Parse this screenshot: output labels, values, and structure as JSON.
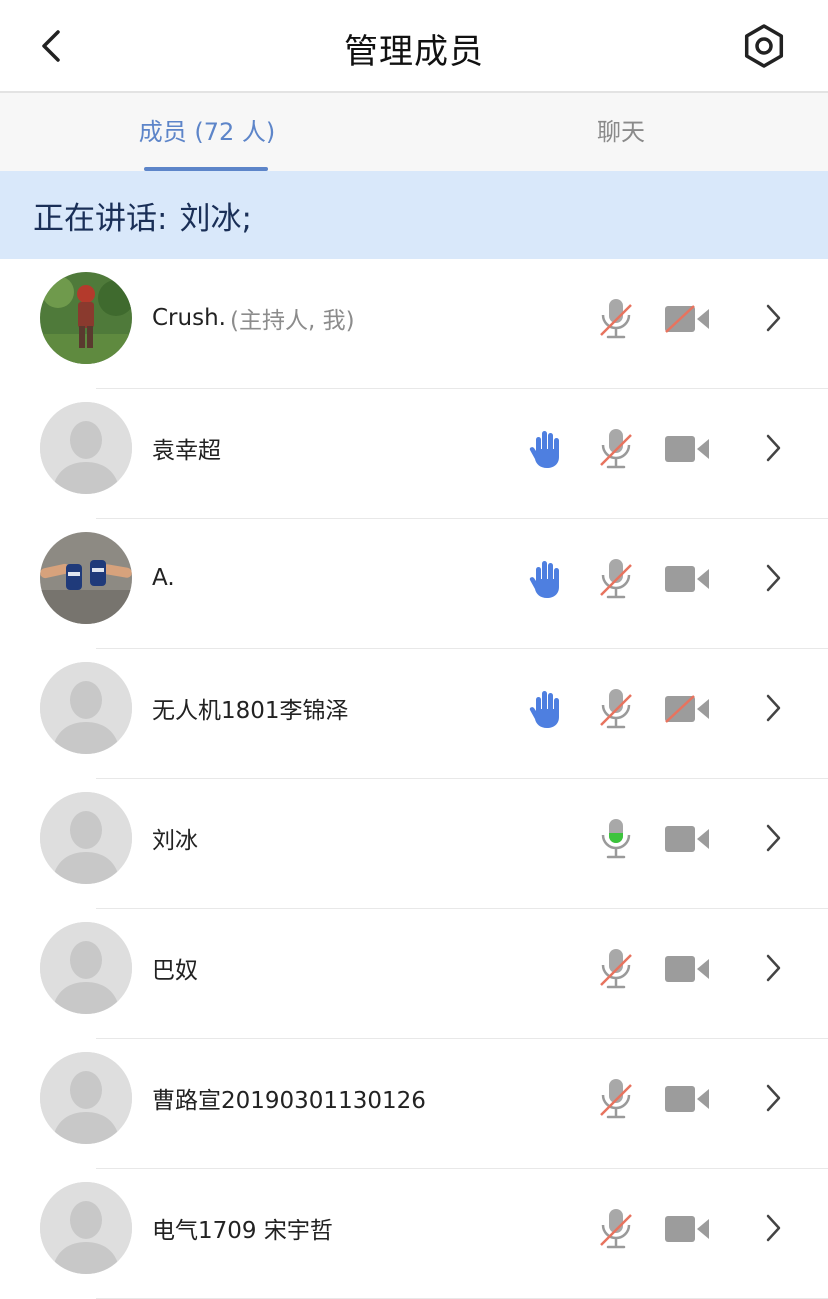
{
  "header": {
    "title": "管理成员",
    "back_icon": "chevron-left-icon",
    "settings_icon": "gear-icon"
  },
  "tabs": [
    {
      "label": "成员 (72 人)",
      "active": true
    },
    {
      "label": "聊天",
      "active": false
    }
  ],
  "speaking": {
    "label": "正在讲话:",
    "name": "刘冰;"
  },
  "colors": {
    "accent": "#5d85c9",
    "speaking_bg": "#d9e8fa",
    "hand": "#4e7fe0",
    "mic_active": "#3cc43c",
    "muted_slash": "#e8735e",
    "icon_gray": "#9a9a9a"
  },
  "members": [
    {
      "name": "Crush.",
      "role": "(主持人, 我)",
      "avatar": "photo-figure",
      "hand_raised": false,
      "mic": "muted",
      "camera": "off"
    },
    {
      "name": "袁幸超",
      "role": "",
      "avatar": "default",
      "hand_raised": true,
      "mic": "muted",
      "camera": "on"
    },
    {
      "name": "A.",
      "role": "",
      "avatar": "photo-cans",
      "hand_raised": true,
      "mic": "muted",
      "camera": "on"
    },
    {
      "name": "无人机1801李锦泽",
      "role": "",
      "avatar": "default",
      "hand_raised": true,
      "mic": "muted",
      "camera": "off"
    },
    {
      "name": "刘冰",
      "role": "",
      "avatar": "default",
      "hand_raised": false,
      "mic": "active",
      "camera": "on"
    },
    {
      "name": "巴奴",
      "role": "",
      "avatar": "default",
      "hand_raised": false,
      "mic": "muted",
      "camera": "on"
    },
    {
      "name": "曹路宣20190301130126",
      "role": "",
      "avatar": "default",
      "hand_raised": false,
      "mic": "muted",
      "camera": "on"
    },
    {
      "name": "电气1709 宋宇哲",
      "role": "",
      "avatar": "default",
      "hand_raised": false,
      "mic": "muted",
      "camera": "on"
    }
  ]
}
